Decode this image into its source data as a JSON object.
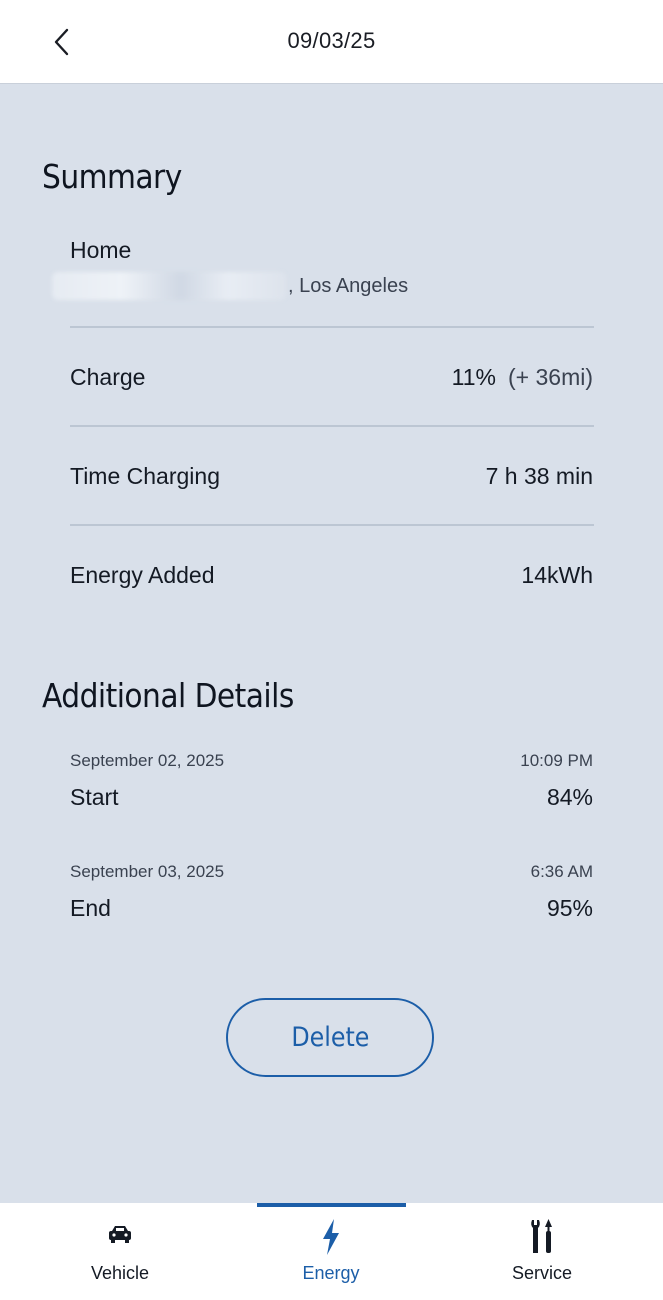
{
  "header": {
    "title": "09/03/25"
  },
  "summary": {
    "title": "Summary",
    "location_name": "Home",
    "location_city": ", Los Angeles",
    "charge_label": "Charge",
    "charge_value": "11%",
    "charge_range": "(+ 36mi)",
    "time_label": "Time Charging",
    "time_value": "7 h 38 min",
    "energy_label": "Energy Added",
    "energy_value": "14kWh"
  },
  "details": {
    "title": "Additional Details",
    "start_date": "September 02, 2025",
    "start_time": "10:09 PM",
    "start_label": "Start",
    "start_value": "84%",
    "end_date": "September 03, 2025",
    "end_time": "6:36 AM",
    "end_label": "End",
    "end_value": "95%"
  },
  "actions": {
    "delete_label": "Delete"
  },
  "nav": {
    "vehicle": "Vehicle",
    "energy": "Energy",
    "service": "Service",
    "active": "Energy"
  },
  "colors": {
    "accent": "#1c5ea8",
    "background": "#d9e0ea"
  }
}
